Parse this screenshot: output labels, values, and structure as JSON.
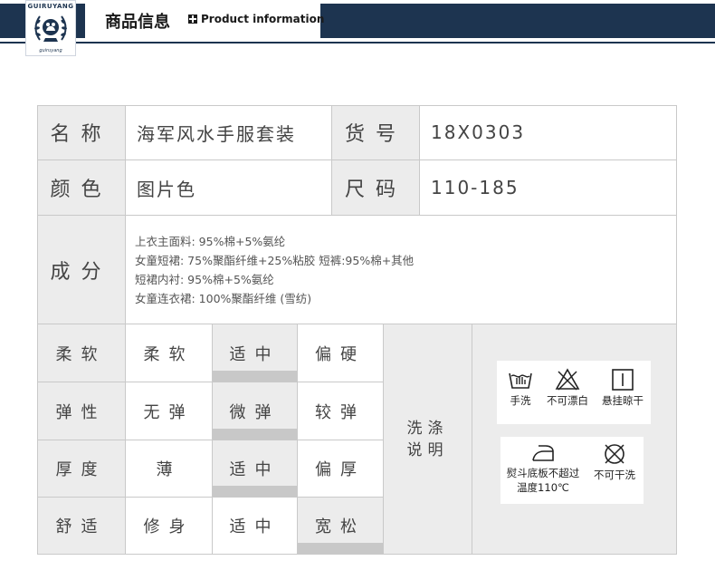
{
  "header": {
    "logo_text": "GUIRUYANG",
    "logo_sub": "guiruyang",
    "title_cn": "商品信息",
    "title_en": "Product information"
  },
  "info": {
    "name_label": "名称",
    "name_value": "海军风水手服套装",
    "item_no_label": "货号",
    "item_no_value": "18X0303",
    "color_label": "颜色",
    "color_value": "图片色",
    "size_label": "尺码",
    "size_value": "110-185"
  },
  "composition": {
    "label": "成分",
    "lines": [
      "上衣主面料: 95%棉+5%氨纶",
      "女童短裙: 75%聚酯纤维+25%粘胶 短裤:95%棉+其他",
      "短裙内衬: 95%棉+5%氨纶",
      "女童连衣裙: 100%聚酯纤维 (雪纺)"
    ]
  },
  "attributes": [
    {
      "label": "柔软",
      "options": [
        "柔软",
        "适中",
        "偏硬"
      ],
      "selected_index": 1
    },
    {
      "label": "弹性",
      "options": [
        "无弹",
        "微弹",
        "较弹"
      ],
      "selected_index": 1
    },
    {
      "label": "厚度",
      "options": [
        "薄",
        "适中",
        "偏厚"
      ],
      "selected_index": 1
    },
    {
      "label": "舒适",
      "options": [
        "修身",
        "适中",
        "宽松"
      ],
      "selected_index": 2
    }
  ],
  "washing": {
    "title_line1": "洗涤",
    "title_line2": "说明",
    "hand_wash": "手洗",
    "no_bleach": "不可漂白",
    "hang_dry": "悬挂晾干",
    "iron_line1": "熨斗底板不超过",
    "iron_line2": "温度110℃",
    "no_dry_clean": "不可干洗"
  }
}
